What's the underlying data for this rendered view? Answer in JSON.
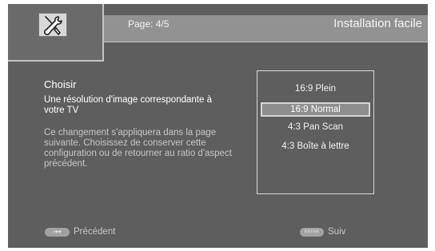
{
  "header": {
    "page_indicator": "Page: 4/5",
    "title": "Installation facile",
    "logo_icon": "wrench-screwdriver-icon"
  },
  "main": {
    "heading": "Choisir",
    "description": "Une résolution d'image correspondante à votre TV",
    "note": "Ce changement s'appliquera dans la page suivante. Choisissez de conserver cette configuration ou de retourner au ratio d'aspect précédent."
  },
  "options": {
    "items": [
      {
        "label": "16:9 Plein",
        "selected": false
      },
      {
        "label": "16:9 Normal",
        "selected": true
      },
      {
        "label": "4:3 Pan Scan",
        "selected": false
      },
      {
        "label": "4:3 Boîte à lettre",
        "selected": false
      }
    ]
  },
  "footer": {
    "prev_key": "I◀◀",
    "prev_label": "Précédent",
    "next_key": "ENTER",
    "next_label": "Suiv"
  },
  "colors": {
    "screen_bg": "#5e5e5e",
    "header_band": "#929292",
    "selection_bg": "#8e8e8e"
  }
}
